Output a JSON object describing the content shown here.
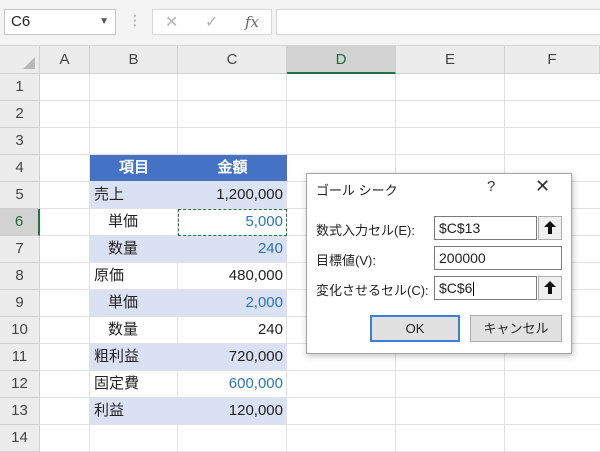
{
  "formula_bar": {
    "name_box": "C6",
    "cancel_glyph": "✕",
    "enter_glyph": "✓",
    "fx_glyph": "fx",
    "formula": ""
  },
  "columns": [
    "A",
    "B",
    "C",
    "D",
    "E",
    "F"
  ],
  "rows": [
    "1",
    "2",
    "3",
    "4",
    "5",
    "6",
    "7",
    "8",
    "9",
    "10",
    "11",
    "12",
    "13",
    "14"
  ],
  "selected": {
    "column": "D",
    "row": "6"
  },
  "table": {
    "header": {
      "item": "項目",
      "amount": "金額"
    },
    "rows": [
      {
        "label": "売上",
        "value": "1,200,000"
      },
      {
        "label": "単価",
        "value": "5,000"
      },
      {
        "label": "数量",
        "value": "240"
      },
      {
        "label": "原価",
        "value": "480,000"
      },
      {
        "label": "単価",
        "value": "2,000"
      },
      {
        "label": "数量",
        "value": "240"
      },
      {
        "label": "粗利益",
        "value": "720,000"
      },
      {
        "label": "固定費",
        "value": "600,000"
      },
      {
        "label": "利益",
        "value": "120,000"
      }
    ]
  },
  "colors": {
    "header_fill": "#4472c4",
    "band_fill": "#d9e1f2",
    "input_text": "#2e74b5",
    "excel_green": "#217346"
  },
  "dialog": {
    "title": "ゴール シーク",
    "help": "?",
    "close": "✕",
    "set_cell_label": "数式入力セル(E):",
    "set_cell_value": "$C$13",
    "to_value_label": "目標値(V):",
    "to_value_value": "200000",
    "changing_cell_label": "変化させるセル(C):",
    "changing_cell_value": "$C$6",
    "ok_label": "OK",
    "cancel_label": "キャンセル",
    "icons": {
      "ref": "collapse-dialog-arrow-icon"
    }
  }
}
